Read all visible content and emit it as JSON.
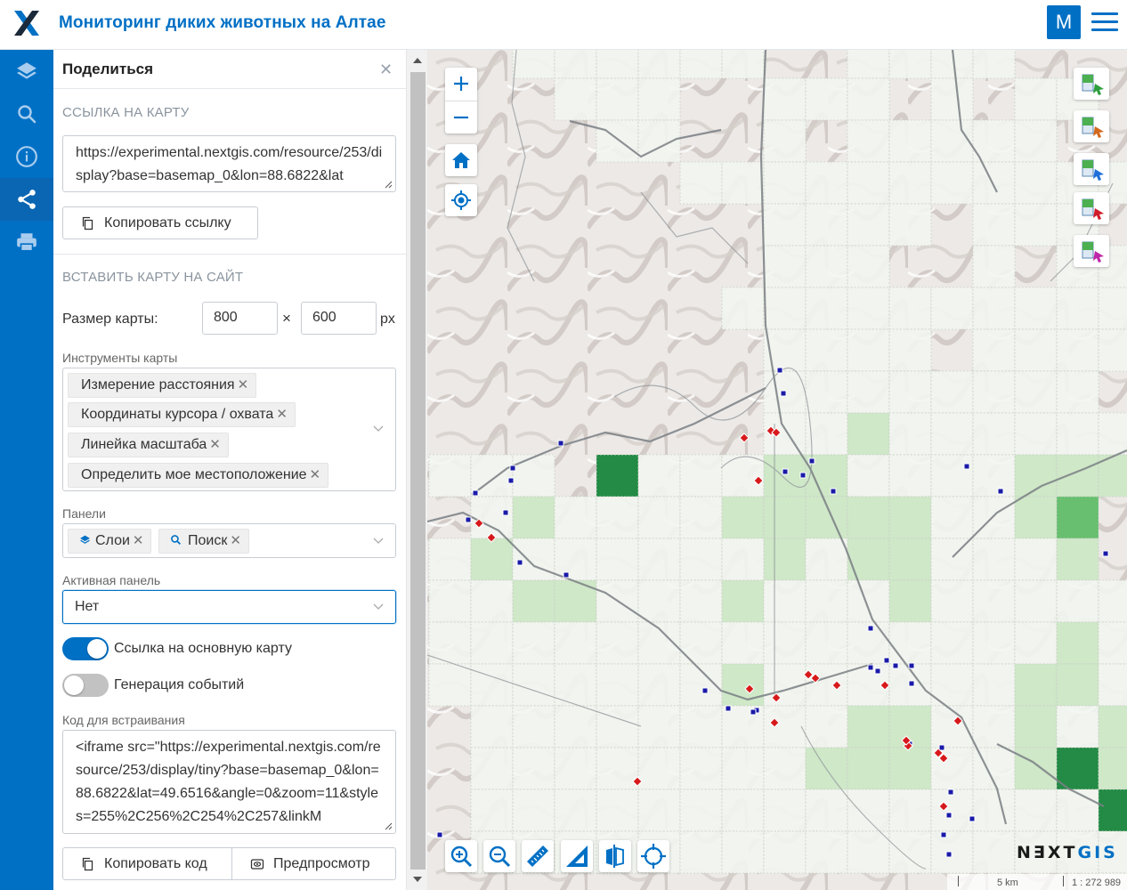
{
  "header": {
    "title": "Мониторинг диких животных на Алтае",
    "avatar_letter": "M"
  },
  "nav": [
    "layers-icon",
    "search-icon",
    "info-icon",
    "share-icon",
    "print-icon"
  ],
  "panel": {
    "title": "Поделиться",
    "link_section": {
      "heading": "ССЫЛКА НА КАРТУ",
      "url": "https://experimental.nextgis.com/resource/253/display?base=basemap_0&lon=88.6822&lat",
      "copy_button": "Копировать ссылку"
    },
    "embed_section": {
      "heading": "ВСТАВИТЬ КАРТУ НА САЙТ",
      "size_label": "Размер карты:",
      "width": "800",
      "times": "×",
      "height": "600",
      "unit": "px",
      "tools_label": "Инструменты карты",
      "tools": [
        "Измерение расстояния",
        "Координаты курсора / охвата",
        "Линейка масштаба",
        "Определить мое местоположение"
      ],
      "panels_label": "Панели",
      "panels": [
        "Слои",
        "Поиск"
      ],
      "active_panel_label": "Активная панель",
      "active_panel_value": "Нет",
      "toggle_main_map": {
        "label": "Ссылка на основную карту",
        "on": true
      },
      "toggle_events": {
        "label": "Генерация событий",
        "on": false
      },
      "code_label": "Код для встраивания",
      "code": "<iframe src=\"https://experimental.nextgis.com/resource/253/display/tiny?base=basemap_0&lon=88.6822&lat=49.6516&angle=0&zoom=11&styles=255%2C256%2C254%2C257&linkM",
      "copy_code_button": "Копировать код",
      "preview_button": "Предпросмотр"
    }
  },
  "map": {
    "brand_prefix": "N∃XT",
    "brand_suffix": "GIS",
    "scale_left": "5 km",
    "scale_right": "1 : 272 989"
  },
  "colors": {
    "accent": "#0070c5",
    "cell_light": "#f3f7f1",
    "cell_mid": "#cfe8c8",
    "cell_strong": "#68bf6f",
    "cell_dark": "#238b45",
    "marker_blue": "#1a1aa8",
    "marker_red": "#d7191c"
  }
}
